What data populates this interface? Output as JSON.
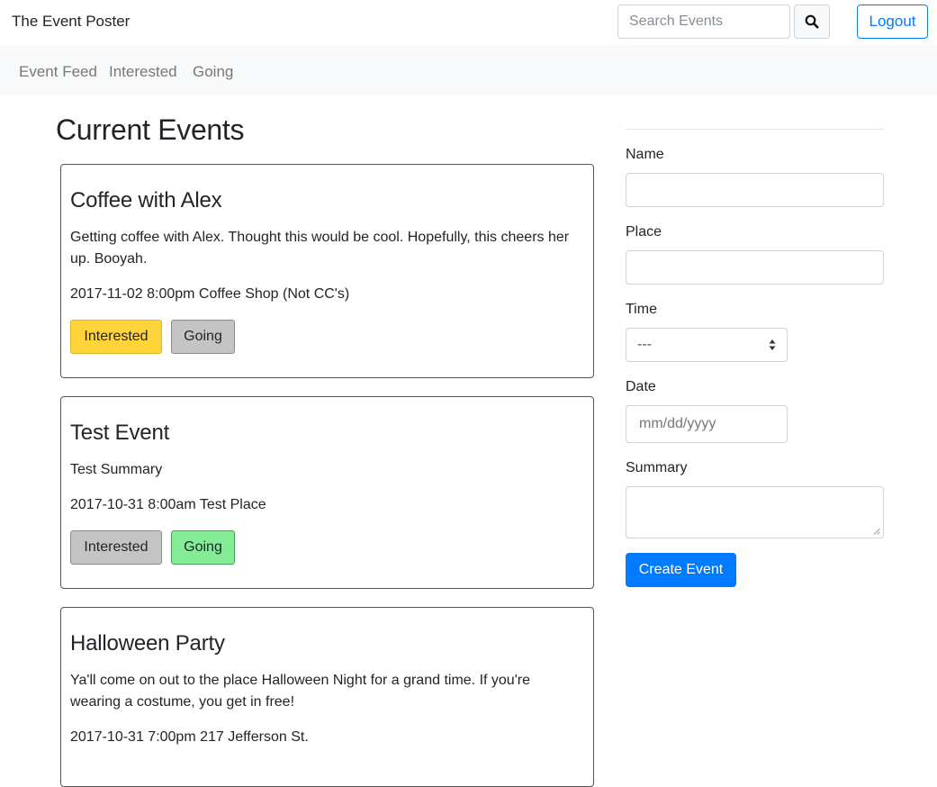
{
  "header": {
    "brand": "The Event Poster",
    "search_placeholder": "Search Events",
    "logout_label": "Logout"
  },
  "nav": {
    "items": [
      {
        "label": "Event Feed"
      },
      {
        "label": "Interested"
      },
      {
        "label": "Going"
      }
    ]
  },
  "main": {
    "title": "Current Events",
    "events": [
      {
        "title": "Coffee with Alex",
        "summary": "Getting coffee with Alex. Thought this would be cool. Hopefully, this cheers her up. Booyah.",
        "meta": "2017-11-02 8:00pm Coffee Shop (Not CC's)",
        "interested_label": "Interested",
        "going_label": "Going",
        "interested_active": true,
        "going_active": false
      },
      {
        "title": "Test Event",
        "summary": "Test Summary",
        "meta": "2017-10-31 8:00am Test Place",
        "interested_label": "Interested",
        "going_label": "Going",
        "interested_active": false,
        "going_active": true
      },
      {
        "title": "Halloween Party",
        "summary": "Ya'll come on out to the place Halloween Night for a grand time. If you're wearing a costume, you get in free!",
        "meta": "2017-10-31 7:00pm 217 Jefferson St."
      }
    ]
  },
  "form": {
    "name_label": "Name",
    "place_label": "Place",
    "time_label": "Time",
    "time_value": "---",
    "date_label": "Date",
    "date_placeholder": "mm/dd/yyyy",
    "summary_label": "Summary",
    "submit_label": "Create Event"
  },
  "colors": {
    "primary": "#007bff",
    "interested_active": "#ffd43b",
    "going_active": "#84ec97",
    "inactive": "#c4c4c4"
  },
  "icons": [
    "search-icon",
    "select-arrows-icon",
    "resize-grip-icon"
  ]
}
